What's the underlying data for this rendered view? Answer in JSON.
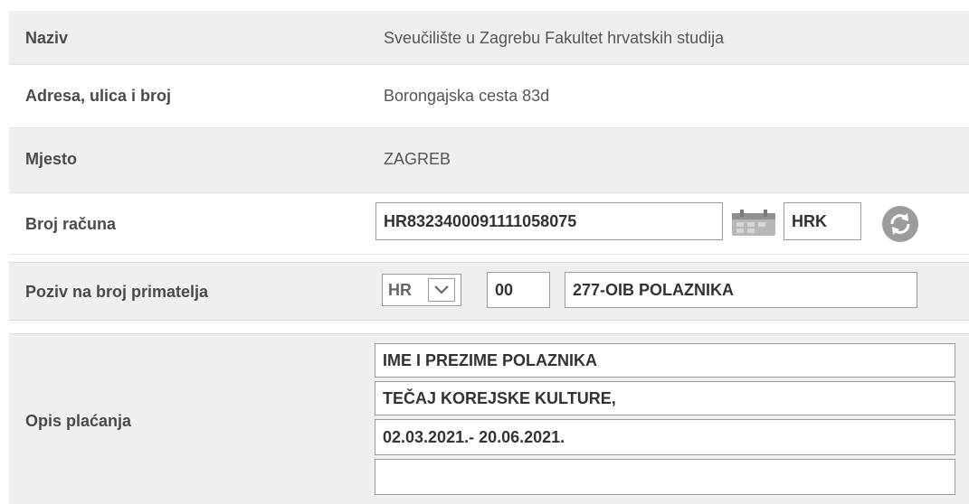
{
  "rows": {
    "naziv": {
      "label": "Naziv",
      "value": "Sveučilište u Zagrebu Fakultet hrvatskih studija"
    },
    "adresa": {
      "label": "Adresa, ulica i broj",
      "value": "Borongajska cesta 83d"
    },
    "mjesto": {
      "label": "Mjesto",
      "value": "ZAGREB"
    },
    "racun": {
      "label": "Broj računa",
      "value": "HR8323400091111058075",
      "currency": "HRK",
      "calendar_icon": "calendar-icon",
      "refresh_icon": "refresh-icon"
    },
    "poziv": {
      "label": "Poziv na broj primatelja",
      "country": "HR",
      "model": "00",
      "reference": "277-OIB POLAZNIKA"
    },
    "opis": {
      "label": "Opis plaćanja",
      "lines": [
        "IME I PREZIME POLAZNIKA",
        "TEČAJ KOREJSKE KULTURE,",
        "02.03.2021.- 20.06.2021.",
        ""
      ]
    }
  },
  "colors": {
    "row_shade": "#efefef",
    "border": "#9a9a9a"
  }
}
